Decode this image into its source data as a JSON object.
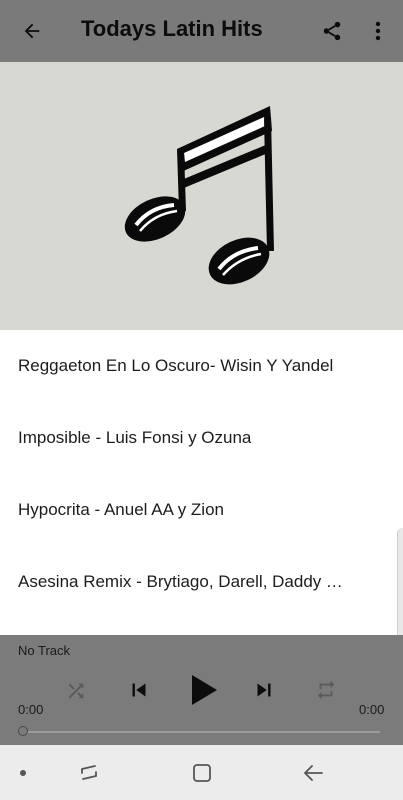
{
  "appbar": {
    "title": "Todays Latin Hits",
    "icons": [
      "arrow-back-icon",
      "share-icon",
      "more-vert-icon"
    ]
  },
  "artwork": {
    "icon": "music-note-icon"
  },
  "tracks": [
    "Reggaeton En Lo Oscuro- Wisin Y Yandel",
    "Imposible - Luis Fonsi y Ozuna",
    "Hypocrita - Anuel AA y Zion",
    "Asesina Remix - Brytiago, Darell, Daddy Yankee, Ozuna y Anuel AA"
  ],
  "player": {
    "now_playing": "No Track",
    "elapsed": "0:00",
    "duration": "0:00",
    "progress": 0,
    "icons": [
      "shuffle-icon",
      "skip-previous-icon",
      "play-icon",
      "skip-next-icon",
      "repeat-icon"
    ]
  },
  "navbar": {
    "icons": [
      "dot-icon",
      "recents-icon",
      "home-icon",
      "back-icon"
    ]
  },
  "colors": {
    "appbar": "#7a7a7a",
    "artwork_bg": "#d7d8d2",
    "player_bg": "#7b7b7b",
    "navbar_bg": "#ececec"
  }
}
